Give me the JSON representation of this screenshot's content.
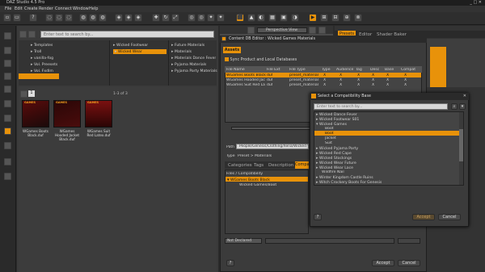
{
  "app": {
    "title": "DAZ Studio 4.5 Pro",
    "menu": [
      "File",
      "Edit",
      "Create",
      "Render",
      "Connect",
      "Window",
      "Help"
    ]
  },
  "content_library": {
    "search_placeholder": "Enter text to search by...",
    "folders": [
      [
        "Templates",
        "Wicked Footwear",
        "Future Materials"
      ],
      [
        "Troll",
        "Wicked Wear",
        "Materials"
      ],
      [
        "vanilla-fog",
        "",
        "Materials Dance Fever"
      ],
      [
        "Vol. Preesets",
        "",
        "Pyjama Materials"
      ],
      [
        "Vol. Fxdlm",
        "",
        "Pyjama Party Materials"
      ]
    ],
    "page_count": "1-3 of 3",
    "page_number": "1",
    "items": [
      {
        "name": "WGames Boots Black.duf",
        "badge": "GAMES"
      },
      {
        "name": "WGames Hooded Jacket Black.duf",
        "badge": "GAMES"
      },
      {
        "name": "WGames Suit Red Latex.duf",
        "badge": "GAMES"
      }
    ]
  },
  "viewport": {
    "view_label": "Perspective View",
    "tabs": [
      "Presets",
      "Editor",
      "Shader Baker"
    ]
  },
  "cms_editor": {
    "title": "Content DB Editor : Wicked Games Materials",
    "assets_tab": "Assets",
    "sync_label": "Sync Product and Local Databases",
    "columns": [
      "File Name",
      "File Ext",
      "File Type",
      "Type",
      "Audience",
      "Tag",
      "Desc",
      "Base",
      "Compat"
    ],
    "rows": [
      [
        "WGames Boots Black",
        "duf",
        "preset_material",
        "X",
        "X",
        "X",
        "X",
        "X",
        "X"
      ],
      [
        "WGames Hooded Jacket Black.duf",
        "duf",
        "preset_material",
        "X",
        "X",
        "X",
        "X",
        "X",
        "X"
      ],
      [
        "WGames Suit Red Latex",
        "duf",
        "preset_material",
        "X",
        "X",
        "X",
        "X",
        "X",
        "X"
      ]
    ],
    "path_label": "Path",
    "path_value": "People/Genesis/Clothing/Xena/Wicked We",
    "type_label": "Type",
    "type_value": "Preset > Materials",
    "sub_tabs": [
      "Categories",
      "Tags",
      "Description",
      "Compat"
    ],
    "files_header": "Files / Compatibility",
    "files": [
      "WGames Boots Black",
      "Wicked Games/Boot"
    ],
    "not_declared": "Not Declared",
    "accept": "Accept",
    "cancel": "Cancel"
  },
  "compat_dialog": {
    "title": "Select a Compatibility Base",
    "search_placeholder": "Enter text to search by...",
    "tree": [
      {
        "label": "Wicked Dance Fever",
        "level": 1,
        "expand": true
      },
      {
        "label": "Wicked Footwear S01",
        "level": 1,
        "expand": true
      },
      {
        "label": "Wicked Games",
        "level": 1,
        "expand": true,
        "open": true
      },
      {
        "label": "Boot",
        "level": 2,
        "expand": false
      },
      {
        "label": "Boot",
        "level": 2,
        "expand": false,
        "selected": true
      },
      {
        "label": "Jacket",
        "level": 2,
        "expand": false
      },
      {
        "label": "Suit",
        "level": 2,
        "expand": false
      },
      {
        "label": "Wicked Pyjama Party",
        "level": 1,
        "expand": true
      },
      {
        "label": "Wicked Red Cape",
        "level": 1,
        "expand": true
      },
      {
        "label": "Wicked Stockings",
        "level": 1,
        "expand": true
      },
      {
        "label": "Wicked Wear Future",
        "level": 1,
        "expand": true
      },
      {
        "label": "Wicked Wear Lace",
        "level": 1,
        "expand": true
      },
      {
        "label": "Wildfire Nail",
        "level": 1,
        "expand": false
      },
      {
        "label": "Winter Kingdom Castle Ruins",
        "level": 1,
        "expand": true
      },
      {
        "label": "Witch Crockery Boots For Genesis",
        "level": 1,
        "expand": true
      }
    ],
    "accept": "Accept",
    "cancel": "Cancel"
  },
  "colors": {
    "accent": "#e8920a",
    "panel": "#3a3a3a",
    "background": "#2b2b2b"
  }
}
